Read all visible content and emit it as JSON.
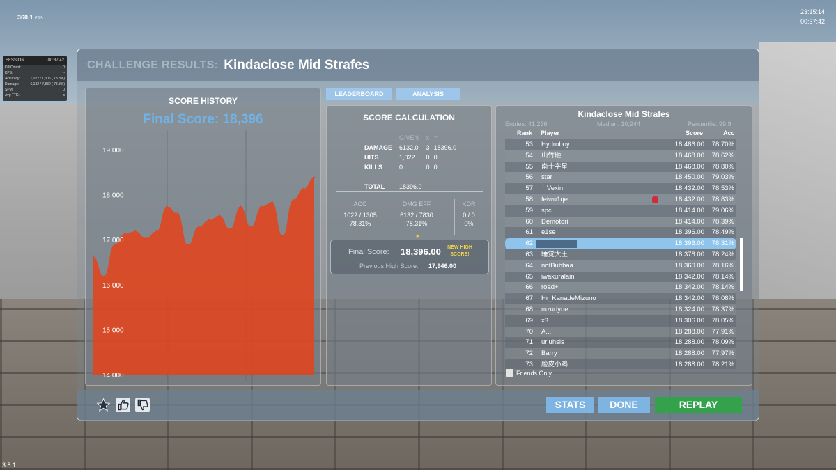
{
  "hud": {
    "fps": "360.1",
    "fps_unit": "FPS",
    "clock_time": "23:15:14",
    "clock_elapsed": "00:37:42",
    "version": "3.8.1"
  },
  "session": {
    "label": "SESSION",
    "time": "00:37:42",
    "rows": [
      {
        "label": "Kill Count:",
        "value": "0"
      },
      {
        "label": "KPS:",
        "value": "--"
      },
      {
        "label": "Accuracy:",
        "value": "1,022 / 1,305  ( 78.3%)"
      },
      {
        "label": "Damage:",
        "value": "6,132 / 7,830  ( 78.3%)"
      },
      {
        "label": "SPM:",
        "value": "0"
      },
      {
        "label": "Avg TTK:",
        "value": "-- --s"
      }
    ]
  },
  "header": {
    "prefix": "CHALLENGE RESULTS:",
    "scenario": "Kindaclose Mid Strafes"
  },
  "history": {
    "title": "SCORE HISTORY",
    "final_score": "Final Score: 18,396"
  },
  "chart_data": {
    "type": "area",
    "title": "SCORE HISTORY",
    "subtitle": "Final Score: 18,396",
    "ylim": [
      14000,
      19000
    ],
    "yticks": [
      "19,000",
      "18,000",
      "17,000",
      "16,000",
      "15,000",
      "14,000"
    ],
    "grid": true,
    "color": "#e2441d",
    "series": [
      {
        "values": [
          16630,
          16200,
          16900,
          17150,
          17200,
          17050,
          17200,
          17750,
          17600,
          16900,
          17300,
          17450,
          17550,
          17250,
          17750,
          17300,
          17750,
          17850,
          17100,
          17900,
          18150,
          18396
        ]
      }
    ]
  },
  "tabs": {
    "leaderboard": "LEADERBOARD",
    "analysis": "ANALYSIS"
  },
  "calc": {
    "title": "SCORE CALCULATION",
    "head_given": "GIVEN",
    "head_x": "x",
    "head_eq": "=",
    "rows": [
      {
        "label": "DAMAGE",
        "given": "6132.0",
        "mult": "3",
        "total": "18396.0"
      },
      {
        "label": "HITS",
        "given": "1,022",
        "mult": "0",
        "total": "0"
      },
      {
        "label": "KILLS",
        "given": "0",
        "mult": "0",
        "total": "0"
      }
    ],
    "total_label": "TOTAL",
    "total_value": "18396.0",
    "acc_head": "ACC",
    "acc_raw": "1022 / 1305",
    "acc_pct": "78.31%",
    "dmg_head": "DMG EFF",
    "dmg_raw": "6132 / 7830",
    "dmg_pct": "78.31%",
    "kdr_head": "KDR",
    "kdr_raw": "0 / 0",
    "kdr_pct": "0%",
    "diamond": "◆",
    "final_label": "Final Score:",
    "final_value": "18,396.00",
    "new_high": "NEW HIGH SCORE!",
    "prev_label": "Previous High Score:",
    "prev_value": "17,946.00"
  },
  "leaderboard": {
    "title": "Kindaclose Mid Strafes",
    "entries": "Entries: 41,236",
    "median": "Median: 10,944",
    "percentile": "Percentile: 99.9",
    "col_rank": "Rank",
    "col_player": "Player",
    "col_score": "Score",
    "col_acc": "Acc",
    "rows": [
      {
        "rank": "53",
        "player": "Hydroboy",
        "score": "18,486.00",
        "acc": "78.70%"
      },
      {
        "rank": "54",
        "player": "山竹砸",
        "score": "18,468.00",
        "acc": "78.62%"
      },
      {
        "rank": "55",
        "player": "南十字星",
        "score": "18,468.00",
        "acc": "78.80%"
      },
      {
        "rank": "56",
        "player": "star",
        "score": "18,450.00",
        "acc": "79.03%"
      },
      {
        "rank": "57",
        "player": "† Vexin",
        "score": "18,432.00",
        "acc": "78.53%"
      },
      {
        "rank": "58",
        "player": "feiwu1qe",
        "score": "18,432.00",
        "acc": "78.83%"
      },
      {
        "rank": "59",
        "player": "spc",
        "score": "18,414.00",
        "acc": "79.06%"
      },
      {
        "rank": "60",
        "player": "Demotori",
        "score": "18,414.00",
        "acc": "78.39%"
      },
      {
        "rank": "61",
        "player": "e1se",
        "score": "18,396.00",
        "acc": "78.49%"
      },
      {
        "rank": "62",
        "player": "",
        "score": "18,396.00",
        "acc": "78.31%"
      },
      {
        "rank": "63",
        "player": "睡觉大王",
        "score": "18,378.00",
        "acc": "78.24%"
      },
      {
        "rank": "64",
        "player": "notBubbaa",
        "score": "18,360.00",
        "acc": "78.16%"
      },
      {
        "rank": "65",
        "player": "iwakuralain",
        "score": "18,342.00",
        "acc": "78.14%"
      },
      {
        "rank": "66",
        "player": "road+",
        "score": "18,342.00",
        "acc": "78.14%"
      },
      {
        "rank": "67",
        "player": "Hr_KanadeMizuno",
        "score": "18,342.00",
        "acc": "78.08%"
      },
      {
        "rank": "68",
        "player": "mzudyne",
        "score": "18,324.00",
        "acc": "78.37%"
      },
      {
        "rank": "69",
        "player": "x3",
        "score": "18,306.00",
        "acc": "78.05%"
      },
      {
        "rank": "70",
        "player": "A...",
        "score": "18,288.00",
        "acc": "77.91%"
      },
      {
        "rank": "71",
        "player": "urluhsis",
        "score": "18,288.00",
        "acc": "78.09%"
      },
      {
        "rank": "72",
        "player": "Barry",
        "score": "18,288.00",
        "acc": "77.97%"
      },
      {
        "rank": "73",
        "player": "脸皮小鸡",
        "score": "18,288.00",
        "acc": "78.21%"
      }
    ],
    "friends_only": "Friends Only"
  },
  "buttons": {
    "stats": "STATS",
    "done": "DONE",
    "replay": "REPLAY"
  },
  "colors": {
    "accent": "#7db4e2",
    "replay": "#33a24a",
    "chart_fill": "#e2441d",
    "new_high": "#f1d24a"
  },
  "icons": [
    "star-icon",
    "thumbs-up-icon",
    "thumbs-down-icon"
  ]
}
